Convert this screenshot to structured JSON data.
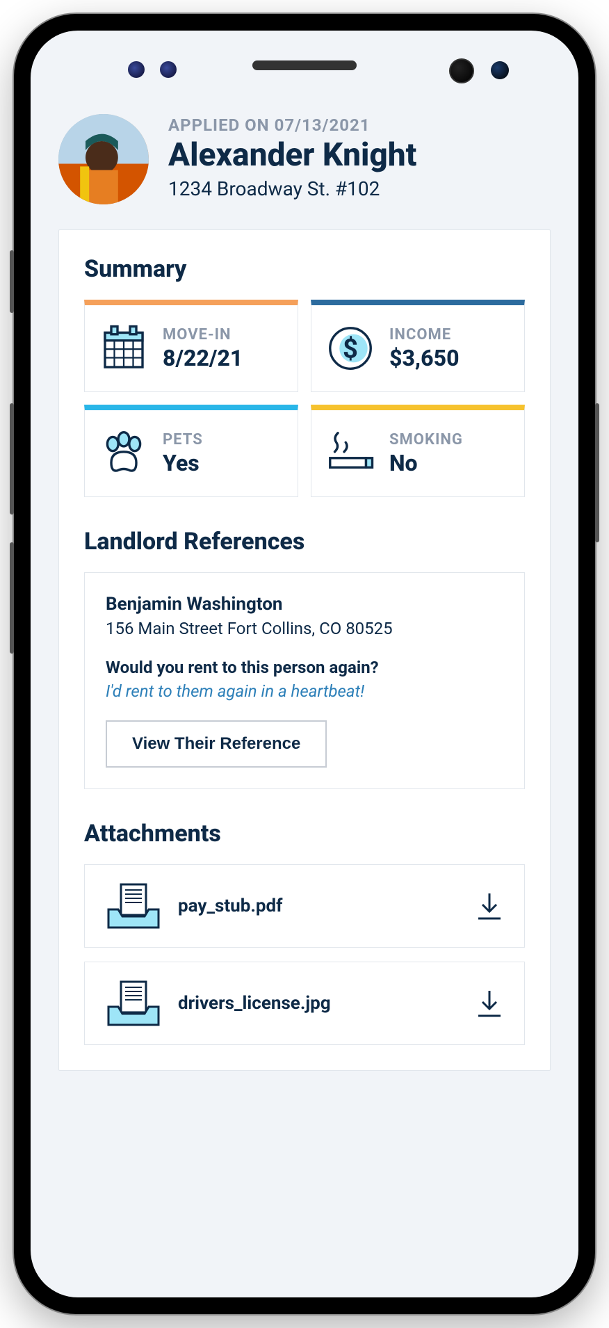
{
  "header": {
    "applied_on_label": "APPLIED ON 07/13/2021",
    "applicant_name": "Alexander Knight",
    "address": "1234 Broadway St. #102"
  },
  "summary": {
    "title": "Summary",
    "cards": [
      {
        "label": "MOVE-IN",
        "value": "8/22/21",
        "accent": "orange",
        "icon": "calendar-icon"
      },
      {
        "label": "INCOME",
        "value": "$3,650",
        "accent": "blue",
        "icon": "dollar-icon"
      },
      {
        "label": "PETS",
        "value": "Yes",
        "accent": "cyan",
        "icon": "paw-icon"
      },
      {
        "label": "SMOKING",
        "value": "No",
        "accent": "yellow",
        "icon": "cigarette-icon"
      }
    ]
  },
  "references": {
    "title": "Landlord References",
    "items": [
      {
        "name": "Benjamin Washington",
        "address": "156 Main Street Fort Collins, CO 80525",
        "question": "Would you rent to this person again?",
        "answer": "I'd rent to them again in a heartbeat!",
        "button_label": "View Their Reference"
      }
    ]
  },
  "attachments": {
    "title": "Attachments",
    "items": [
      {
        "filename": "pay_stub.pdf"
      },
      {
        "filename": "drivers_license.jpg"
      }
    ]
  },
  "colors": {
    "accent_orange": "#f5a05a",
    "accent_blue": "#2c6b9e",
    "accent_cyan": "#29b6e8",
    "accent_yellow": "#f6c22d",
    "icon_fill": "#9ee5f7",
    "text_primary": "#0e2a47",
    "text_muted": "#8a96a8",
    "link": "#2c7fb8"
  }
}
